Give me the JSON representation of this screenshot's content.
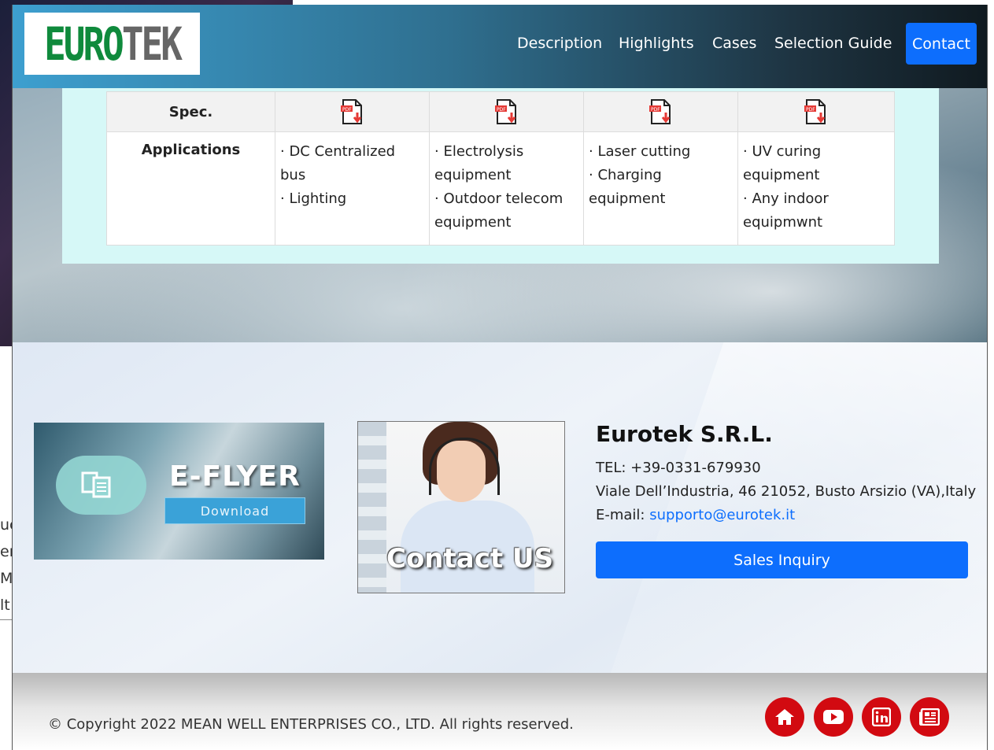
{
  "background_window": {
    "text_fragments": [
      "uc",
      "en",
      "M",
      "lt"
    ]
  },
  "navbar": {
    "logo_text_left": "EURO",
    "logo_text_right": "TEK",
    "links": [
      "Description",
      "Highlights",
      "Cases",
      "Selection Guide"
    ],
    "contact_label": "Contact"
  },
  "table": {
    "spec_label": "Spec.",
    "spec_icons": [
      "pdf-download-icon",
      "pdf-download-icon",
      "pdf-download-icon",
      "pdf-download-icon"
    ],
    "applications_label": "Applications",
    "applications": [
      [
        "· DC Centralized bus",
        "· Lighting"
      ],
      [
        "· Electrolysis equipment",
        "· Outdoor telecom equipment"
      ],
      [
        "· Laser cutting",
        "· Charging equipment"
      ],
      [
        "· UV curing equipment",
        "· Any indoor equipmwnt"
      ]
    ]
  },
  "eflyer": {
    "title": "E-FLYER",
    "button_label": "Download"
  },
  "contact_us_banner": {
    "title": "Contact US"
  },
  "company": {
    "name": "Eurotek S.R.L.",
    "tel": "TEL: +39-0331-679930",
    "address": "Viale Dell’Industria, 46 21052, Busto Arsizio (VA),Italy",
    "email_label": "E-mail: ",
    "email": "supporto@eurotek.it",
    "sales_button_label": "Sales Inquiry"
  },
  "footer": {
    "copyright": "© Copyright 2022 MEAN WELL ENTERPRISES CO., LTD. All rights reserved.",
    "social_icons": [
      "home-icon",
      "youtube-icon",
      "linkedin-icon",
      "newspaper-icon"
    ],
    "social_color": "#d20a11"
  },
  "colors": {
    "primary_button": "#0d6efd",
    "panel_bg": "#d6f8f7",
    "logo_green": "#0f8a3c"
  }
}
